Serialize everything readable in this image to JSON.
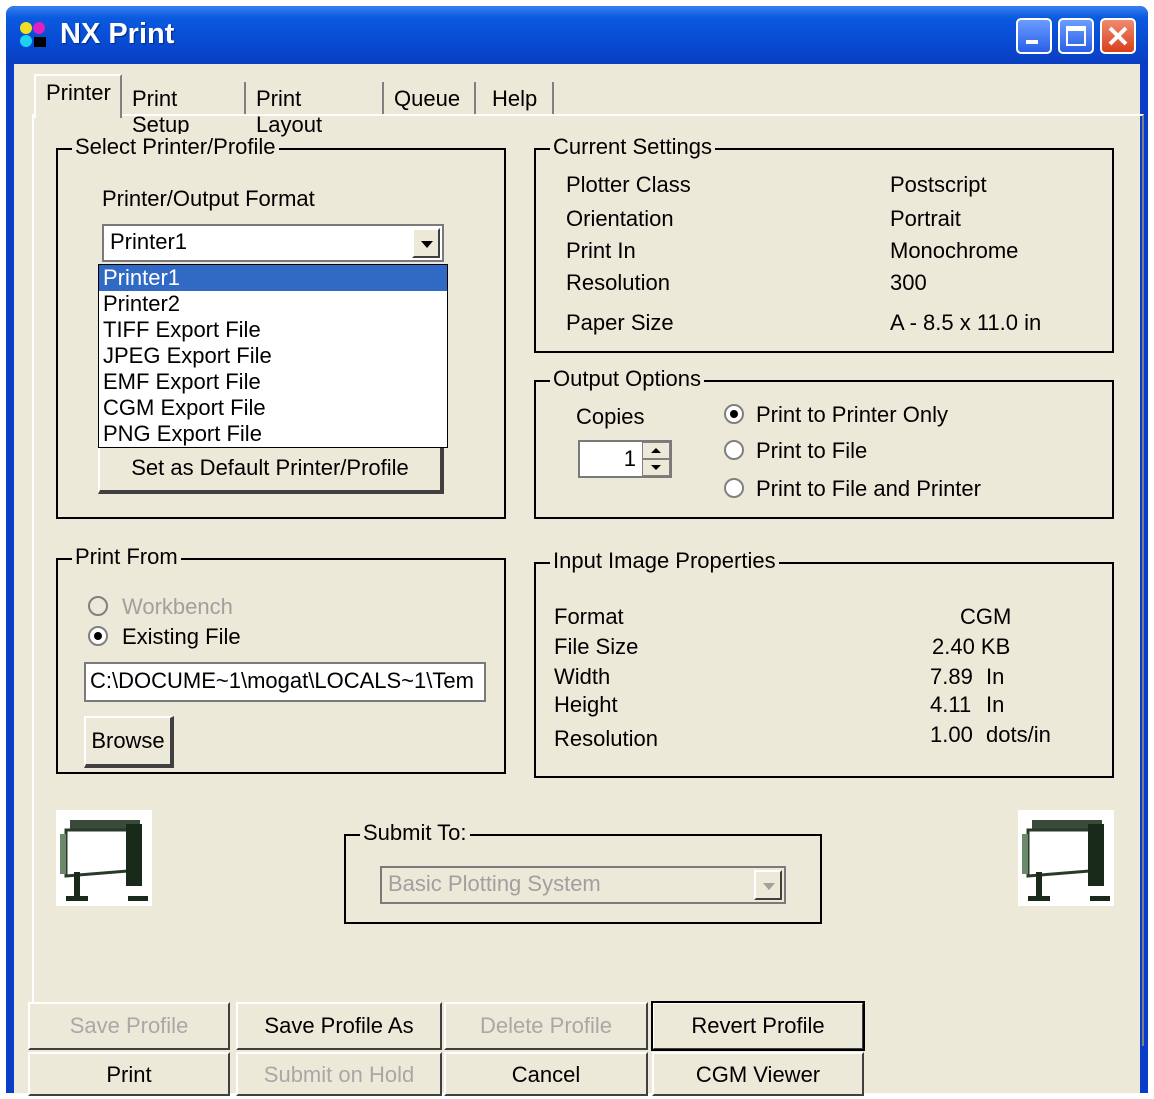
{
  "window": {
    "title": "NX Print"
  },
  "tabs": [
    {
      "label": "Printer",
      "active": true
    },
    {
      "label": "Print Setup"
    },
    {
      "label": "Print Layout"
    },
    {
      "label": "Queue"
    },
    {
      "label": "Help"
    }
  ],
  "select_printer": {
    "legend": "Select Printer/Profile",
    "format_label": "Printer/Output Format",
    "combo_value": "Printer1",
    "options": [
      "Printer1",
      "Printer2",
      "TIFF Export File",
      "JPEG Export File",
      "EMF Export File",
      "CGM Export File",
      "PNG Export File"
    ],
    "selected_index": 0,
    "default_button": "Set as Default Printer/Profile"
  },
  "current_settings": {
    "legend": "Current Settings",
    "rows": [
      {
        "label": "Plotter Class",
        "value": "Postscript"
      },
      {
        "label": "Orientation",
        "value": "Portrait"
      },
      {
        "label": "Print In",
        "value": "Monochrome"
      },
      {
        "label": "Resolution",
        "value": "300"
      },
      {
        "label": "Paper Size",
        "value": "A - 8.5 x 11.0 in"
      }
    ]
  },
  "output_options": {
    "legend": "Output Options",
    "copies_label": "Copies",
    "copies_value": "1",
    "radios": [
      {
        "label": "Print to Printer Only",
        "checked": true
      },
      {
        "label": "Print to File",
        "checked": false
      },
      {
        "label": "Print to File and Printer",
        "checked": false
      }
    ]
  },
  "print_from": {
    "legend": "Print From",
    "radios": [
      {
        "label": "Workbench",
        "checked": false,
        "disabled": true
      },
      {
        "label": "Existing File",
        "checked": true,
        "disabled": false
      }
    ],
    "path_value": "C:\\DOCUME~1\\mogat\\LOCALS~1\\Tem",
    "browse_label": "Browse"
  },
  "input_image": {
    "legend": "Input Image Properties",
    "rows": [
      {
        "label": "Format",
        "value": "CGM",
        "unit": ""
      },
      {
        "label": "File Size",
        "value": "2.40 KB",
        "unit": ""
      },
      {
        "label": "Width",
        "value": "7.89",
        "unit": "In"
      },
      {
        "label": "Height",
        "value": "4.11",
        "unit": "In"
      },
      {
        "label": "Resolution",
        "value": "1.00",
        "unit": "dots/in"
      }
    ]
  },
  "submit_to": {
    "legend": "Submit To:",
    "value": "Basic Plotting System"
  },
  "buttons": {
    "save_profile": "Save Profile",
    "save_profile_as": "Save Profile As",
    "delete_profile": "Delete Profile",
    "revert_profile": "Revert Profile",
    "print": "Print",
    "submit_on_hold": "Submit on Hold",
    "cancel": "Cancel",
    "cgm_viewer": "CGM Viewer"
  },
  "icons": {
    "app": "nx-app-icon",
    "plotter": "plotter-icon"
  },
  "colors": {
    "titlebar": "#0a5ae0",
    "selection": "#316ac5",
    "face": "#ece9d8"
  }
}
